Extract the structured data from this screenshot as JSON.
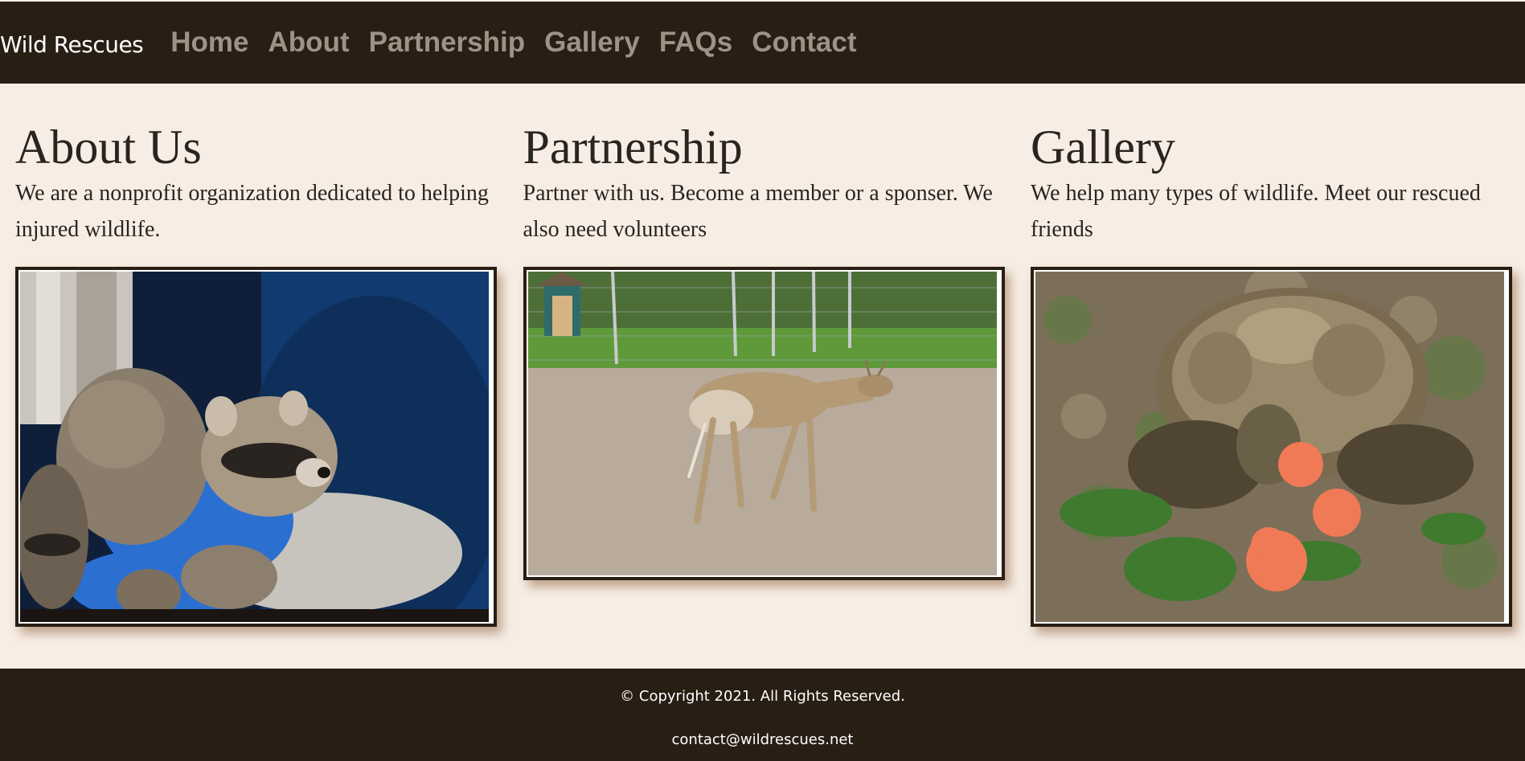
{
  "site": {
    "brand": "Wild Rescues"
  },
  "nav": {
    "items": [
      {
        "label": "Home"
      },
      {
        "label": "About"
      },
      {
        "label": "Partnership"
      },
      {
        "label": "Gallery"
      },
      {
        "label": "FAQs"
      },
      {
        "label": "Contact"
      }
    ]
  },
  "sections": [
    {
      "heading": "About Us",
      "text": "We are a nonprofit organization dedicated to helping injured wildlife."
    },
    {
      "heading": "Partnership",
      "text": "Partner with us. Become a member or a sponser. We also need volunteers"
    },
    {
      "heading": "Gallery",
      "text": "We help many types of wildlife. Meet our rescued friends"
    }
  ],
  "footer": {
    "copyright": "© Copyright 2021. All Rights Reserved.",
    "email": "contact@wildrescues.net"
  },
  "colors": {
    "header_bg": "#291e14",
    "page_bg": "#f7ede4",
    "nav_link": "#9c9286",
    "text": "#2a2420"
  }
}
